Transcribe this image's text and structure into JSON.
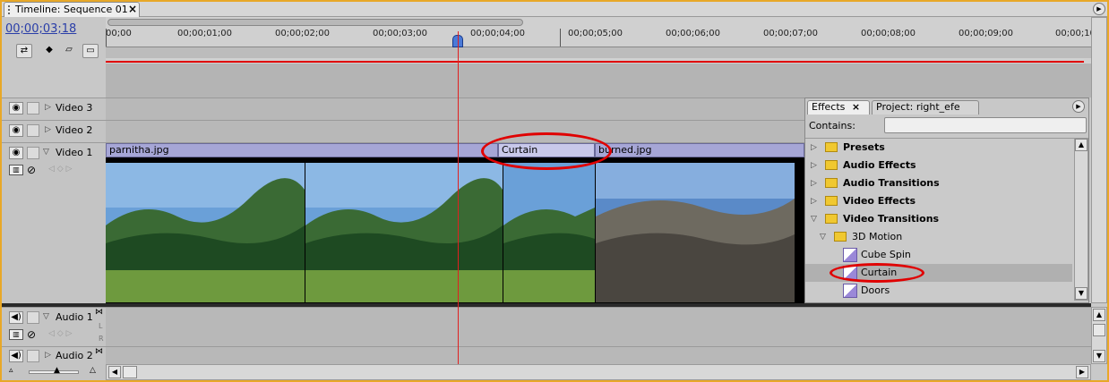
{
  "tab": {
    "title": "Timeline: Sequence 01",
    "close": "×"
  },
  "timecode": "00;00;03;18",
  "ruler": {
    "ticks": [
      "00;00",
      "00;00;01;00",
      "00;00;02;00",
      "00;00;03;00",
      "00;00;04;00",
      "00;00;05;00",
      "00;00;06;00",
      "00;00;07;00",
      "00;00;08;00",
      "00;00;09;00",
      "00;00;10"
    ]
  },
  "tracks": {
    "video3": "Video 3",
    "video2": "Video 2",
    "video1": "Video 1",
    "audio1": "Audio 1",
    "audio2": "Audio 2"
  },
  "clips": {
    "clip1": "parnitha.jpg",
    "transition": "Curtain",
    "clip2": "burned.jpg"
  },
  "effects_panel": {
    "tab_effects": "Effects",
    "tab_project": "Project: right_efe",
    "contains_label": "Contains:",
    "contains_value": "",
    "tree": {
      "presets": "Presets",
      "audio_effects": "Audio Effects",
      "audio_transitions": "Audio Transitions",
      "video_effects": "Video Effects",
      "video_transitions": "Video Transitions",
      "motion_3d": "3D Motion",
      "cube_spin": "Cube Spin",
      "curtain": "Curtain",
      "doors": "Doors"
    }
  },
  "audio_labels": {
    "l": "L",
    "r": "R"
  },
  "colors": {
    "annotation": "#e00000",
    "timecode": "#2a3ea8",
    "clip_header": "#a6a6d6",
    "frame": "#e8a828"
  }
}
